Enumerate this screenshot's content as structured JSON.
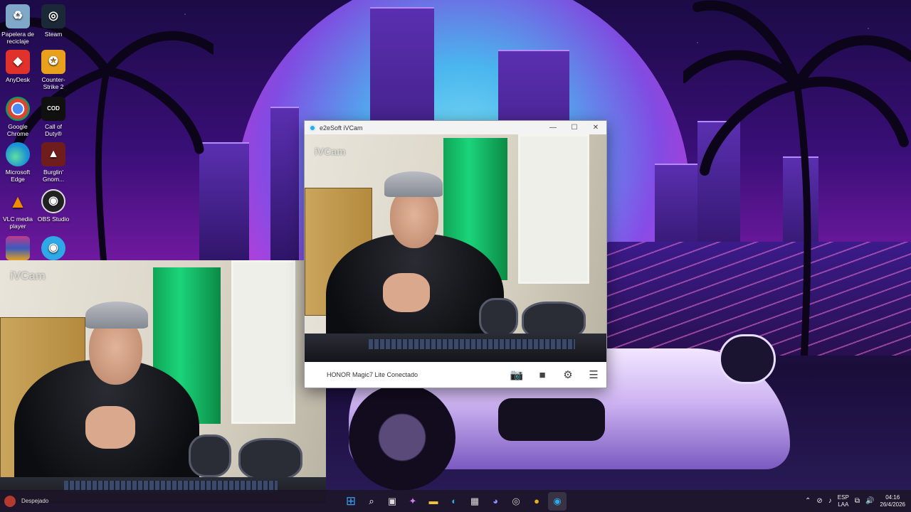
{
  "desktop_icons": [
    {
      "id": "recycle",
      "label": "Papelera de reciclaje",
      "icon": "recycle-bin-icon",
      "color": "#7fa8c9"
    },
    {
      "id": "steam",
      "label": "Steam",
      "icon": "steam-icon",
      "color": "#1b2838"
    },
    {
      "id": "anydesk",
      "label": "AnyDesk",
      "icon": "anydesk-icon",
      "color": "#e0312b"
    },
    {
      "id": "cs2",
      "label": "Counter-Strike 2",
      "icon": "cs2-icon",
      "color": "#e9a11d"
    },
    {
      "id": "chrome",
      "label": "Google Chrome",
      "icon": "chrome-icon",
      "color": "#2f8a3a"
    },
    {
      "id": "cod",
      "label": "Call of Duty®",
      "icon": "cod-icon",
      "color": "#101010"
    },
    {
      "id": "edge",
      "label": "Microsoft Edge",
      "icon": "edge-icon",
      "color": "#1a8fd6"
    },
    {
      "id": "burglin",
      "label": "Burglin' Gnom...",
      "icon": "burglin-gnomes-icon",
      "color": "#6e1c1c"
    },
    {
      "id": "vlc",
      "label": "VLC media player",
      "icon": "vlc-icon",
      "color": "#f08a00"
    },
    {
      "id": "obs",
      "label": "OBS Studio",
      "icon": "obs-icon",
      "color": "#222222"
    },
    {
      "id": "winrar",
      "label": "",
      "icon": "winrar-icon",
      "color": "#7a2f8a"
    },
    {
      "id": "ivcam",
      "label": "",
      "icon": "ivcam-icon",
      "color": "#2ea8e6"
    }
  ],
  "preview_overlay": {
    "watermark": "iVCam"
  },
  "ivcam_window": {
    "title": "e2eSoft iVCam",
    "controls": {
      "minimize": "—",
      "maximize": "☐",
      "close": "✕"
    },
    "watermark": "iVCam",
    "status_text": "HONOR Magic7 Lite Conectado",
    "toolbar": [
      {
        "id": "snapshot",
        "icon": "camera-icon",
        "glyph": "📷"
      },
      {
        "id": "record",
        "icon": "video-camera-icon",
        "glyph": "■"
      },
      {
        "id": "settings",
        "icon": "gear-icon",
        "glyph": "⚙"
      },
      {
        "id": "menu",
        "icon": "hamburger-menu-icon",
        "glyph": "☰"
      }
    ]
  },
  "taskbar": {
    "weather": {
      "label": "Despejado"
    },
    "apps": [
      {
        "id": "start",
        "icon": "windows-start-icon",
        "glyph": "⊞",
        "color": "#3a9df0"
      },
      {
        "id": "search",
        "icon": "search-icon",
        "glyph": "⌕",
        "color": "#ffffff"
      },
      {
        "id": "taskview",
        "icon": "task-view-icon",
        "glyph": "▣",
        "color": "#dddddd"
      },
      {
        "id": "copilot",
        "icon": "copilot-icon",
        "glyph": "✦",
        "color": "#d27cf0"
      },
      {
        "id": "explorer",
        "icon": "file-explorer-icon",
        "glyph": "▬",
        "color": "#f2c23a"
      },
      {
        "id": "edge",
        "icon": "edge-icon",
        "glyph": "◐",
        "color": "#2fa6e0"
      },
      {
        "id": "store",
        "icon": "microsoft-store-icon",
        "glyph": "▦",
        "color": "#dddddd"
      },
      {
        "id": "discord",
        "icon": "discord-icon",
        "glyph": "◕",
        "color": "#5865f2"
      },
      {
        "id": "steam",
        "icon": "steam-icon",
        "glyph": "◎",
        "color": "#cccccc"
      },
      {
        "id": "chrome",
        "icon": "chrome-icon",
        "glyph": "●",
        "color": "#e5b11f"
      },
      {
        "id": "ivcam",
        "icon": "ivcam-icon",
        "glyph": "◉",
        "color": "#2ea8e6"
      }
    ],
    "tray": {
      "lang_top": "ESP",
      "lang_bottom": "LAA",
      "time": "04:16",
      "date": "26/4/2026"
    }
  }
}
